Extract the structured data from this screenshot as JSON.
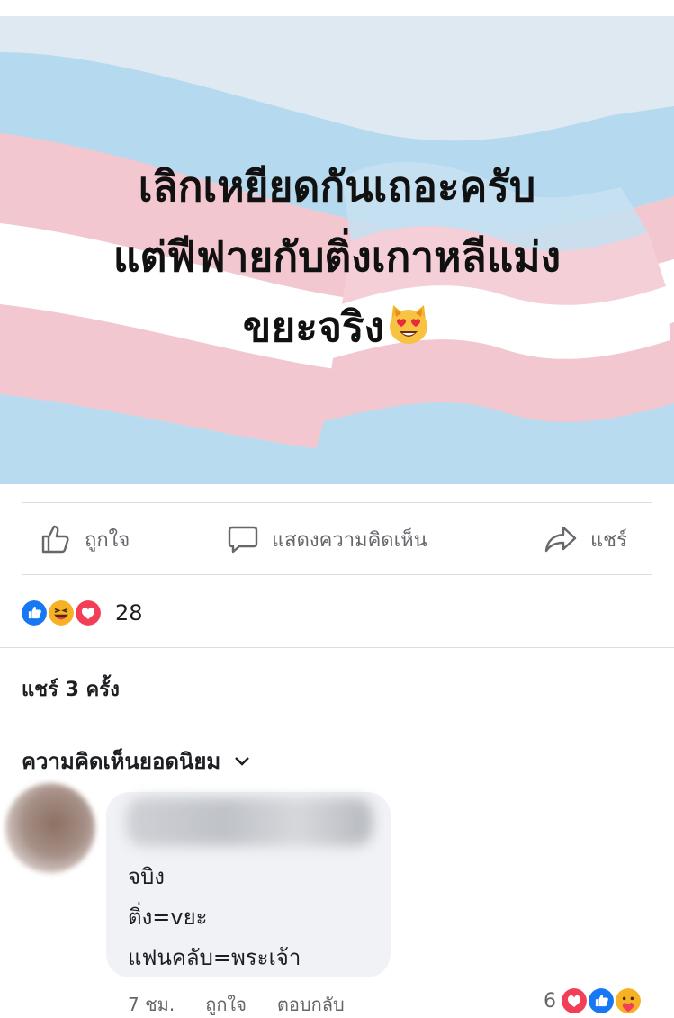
{
  "post": {
    "text_lines": [
      "เลิกเหยียดกันเถอะครับ",
      "แต่ฟีฟายกับติ่งเกาหลีแม่ง",
      "ขยะจริง"
    ],
    "emoji": "smiling-cat-heart-eyes"
  },
  "actions": {
    "like_label": "ถูกใจ",
    "comment_label": "แสดงความคิดเห็น",
    "share_label": "แชร์"
  },
  "reactions": {
    "icons": [
      "like",
      "haha",
      "love"
    ],
    "count": "28"
  },
  "shares_text": "แชร์ 3 ครั้ง",
  "comments_sort_label": "ความคิดเห็นยอดนิยม",
  "comment": {
    "lines": [
      "จบิง",
      "ติ่ง=vยะ",
      "แฟนคลับ=พระเจ้า"
    ],
    "time": "7 ชม.",
    "like_label": "ถูกใจ",
    "reply_label": "ตอบกลับ",
    "reaction_count": "6",
    "reaction_icons": [
      "love",
      "like",
      "care"
    ]
  },
  "colors": {
    "like_blue": "#1877f2",
    "love_red": "#f33e58",
    "haha_yellow": "#f7b125",
    "flag_pink": "#f2c4cf",
    "flag_blue": "#a9d4ee",
    "text_gray": "#65676b"
  }
}
